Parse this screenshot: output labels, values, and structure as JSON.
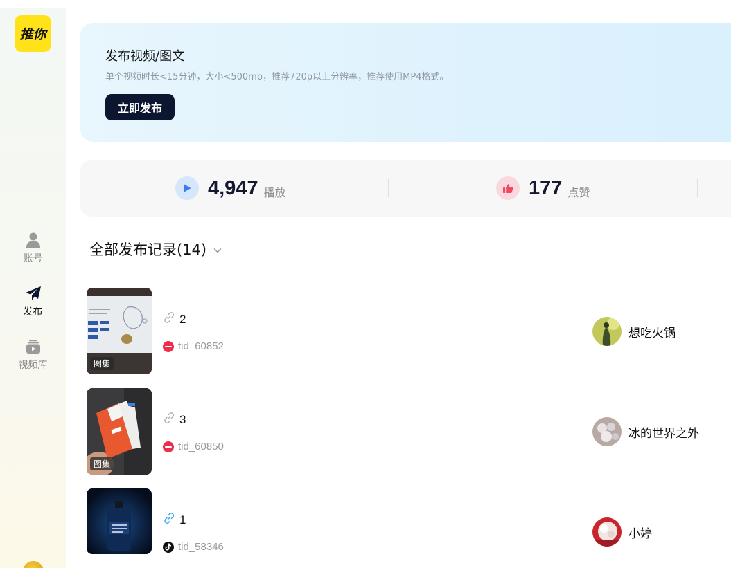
{
  "app": {
    "logo_text": "推你"
  },
  "sidebar": {
    "items": [
      {
        "label": "账号",
        "icon": "user-icon"
      },
      {
        "label": "发布",
        "icon": "paper-plane-icon"
      },
      {
        "label": "视频库",
        "icon": "video-library-icon"
      }
    ]
  },
  "banner": {
    "title": "发布视频/图文",
    "description": "单个视频时长<15分钟，大小<500mb，推荐720p以上分辨率，推荐使用MP4格式。",
    "button_label": "立即发布"
  },
  "stats": {
    "plays": {
      "value": "4,947",
      "unit": "播放",
      "icon": "play-icon"
    },
    "likes": {
      "value": "177",
      "unit": "点赞",
      "icon": "thumbs-up-icon"
    }
  },
  "records": {
    "title": "全部发布记录(14)",
    "items": [
      {
        "thumb_tag": "图集",
        "link_count": "2",
        "account": "tid_60852",
        "platform": "xiaohongshu",
        "user": "想吃火锅"
      },
      {
        "thumb_tag": "图集",
        "link_count": "3",
        "account": "tid_60850",
        "platform": "xiaohongshu",
        "user": "冰的世界之外"
      },
      {
        "thumb_tag": "",
        "link_count": "1",
        "account": "tid_58346",
        "platform": "douyin",
        "user": "小婷"
      }
    ]
  },
  "colors": {
    "accent_dark": "#0c1631",
    "logo_yellow": "#ffe21a",
    "banner_bg": "#def2fd",
    "xiaohongshu_red": "#ee2d4d"
  }
}
